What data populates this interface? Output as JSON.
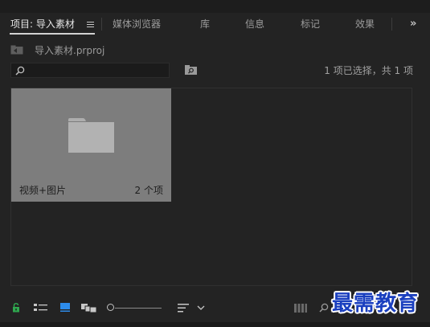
{
  "tabs": [
    {
      "label": "项目: 导入素材",
      "active": true
    },
    {
      "label": "媒体浏览器",
      "active": false
    },
    {
      "label": "库",
      "active": false
    },
    {
      "label": "信息",
      "active": false
    },
    {
      "label": "标记",
      "active": false
    },
    {
      "label": "效果",
      "active": false
    }
  ],
  "tab_icons": {
    "panel_menu": "hamburger-icon",
    "overflow": "chevron-double-right-icon"
  },
  "breadcrumb": {
    "icon": "project-bin-up-icon",
    "label": "导入素材.prproj"
  },
  "search": {
    "value": "",
    "placeholder": ""
  },
  "selection_status": "1 项已选择，共 1 项",
  "items": [
    {
      "name": "视频+图片",
      "count": "2 个项",
      "icon": "folder-icon"
    }
  ],
  "footer": {
    "icons": [
      "lock-icon",
      "list-view-icon",
      "icon-view-icon",
      "freeform-view-icon",
      "zoom-slider",
      "sort-icon",
      "chevron-down-icon",
      "automate-to-sequence-icon",
      "find-icon"
    ],
    "zoom_level": 0.0
  },
  "watermark": "最需教育",
  "colors": {
    "lock_green": "#2fa84f",
    "icon_view_blue": "#2d8ceb",
    "tile_bg": "#7d7d7d",
    "watermark_blue": "#1a3fbf"
  }
}
